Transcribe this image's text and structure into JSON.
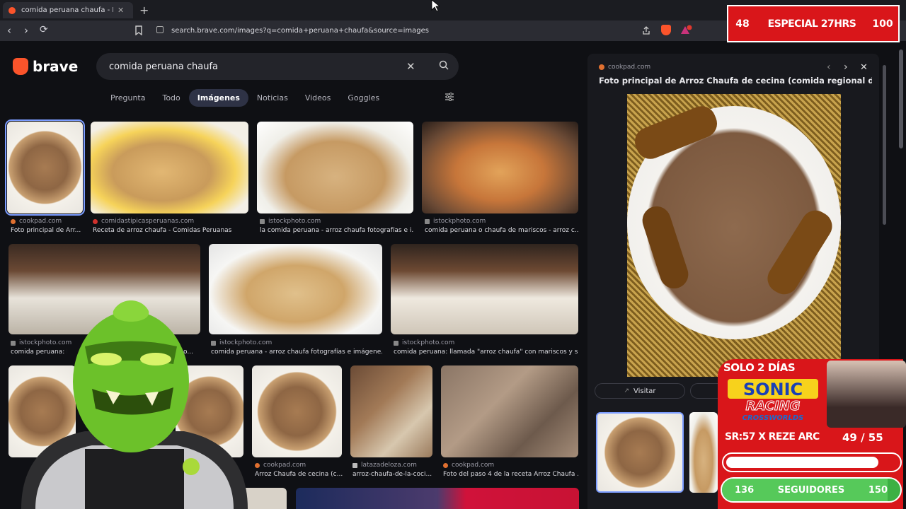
{
  "browser": {
    "tab_title": "comida peruana chaufa - Brave S",
    "tab_close": "✕",
    "new_tab": "+",
    "url": "search.brave.com/images?q=comida+peruana+chaufa&source=images",
    "back": "‹",
    "forward": "›",
    "reload": "⟳"
  },
  "overlay_top": {
    "left": "48",
    "middle": "ESPECIAL 27HRS",
    "right": "100"
  },
  "brave": {
    "logo_text": "brave",
    "search_value": "comida peruana chaufa",
    "clear": "✕",
    "tabs": [
      "Pregunta",
      "Todo",
      "Imágenes",
      "Noticias",
      "Videos",
      "Goggles"
    ],
    "active_tab": "Imágenes"
  },
  "results": [
    {
      "source": "cookpad.com",
      "caption": "Foto principal de Arr..."
    },
    {
      "source": "comidastipicasperuanas.com",
      "caption": "Receta de arroz chaufa - Comidas Peruanas"
    },
    {
      "source": "istockphoto.com",
      "caption": "la comida peruana - arroz chaufa fotografías e i..."
    },
    {
      "source": "istockphoto.com",
      "caption": "comida peruana o chaufa de mariscos - arroz c..."
    },
    {
      "source": "istockphoto.com",
      "caption": "comida peruana: ll..."
    },
    {
      "source": "",
      "caption": "...s y so..."
    },
    {
      "source": "istockphoto.com",
      "caption": "comida peruana - arroz chaufa fotografías e imágene..."
    },
    {
      "source": "istockphoto.com",
      "caption": "comida peruana: llamada \"arroz chaufa\" con mariscos y s..."
    },
    {
      "source": "cookpad.com",
      "caption": "Arroz Chaufa de cecina (c..."
    },
    {
      "source": "latazadeloza.com",
      "caption": "arroz-chaufa-de-la-coci..."
    },
    {
      "source": "cookpad.com",
      "caption": "Foto del paso 4 de la receta Arroz Chaufa ..."
    }
  ],
  "panel": {
    "source": "cookpad.com",
    "title": "Foto principal de Arroz Chaufa de cecina (comida regional de la...",
    "visit": "Visitar",
    "prev": "‹",
    "next": "›",
    "close": "✕"
  },
  "promo": {
    "banner": "SOLO 2 DÍAS",
    "logo_top": "SONIC",
    "logo_mid": "RACING",
    "logo_bot": "CROSSWORLDS",
    "line": "SR:57 X REZE ARC",
    "count": "49 / 55",
    "bar1_progress": 0.89,
    "followers_left": "136",
    "followers_label": "SEGUIDORES",
    "followers_right": "150",
    "followers_progress": 0.93
  },
  "colors": {
    "brave_orange": "#fb542b",
    "accent_blue": "#7b9cff",
    "overlay_red": "#d9161a",
    "followers_green": "#3cb043"
  }
}
